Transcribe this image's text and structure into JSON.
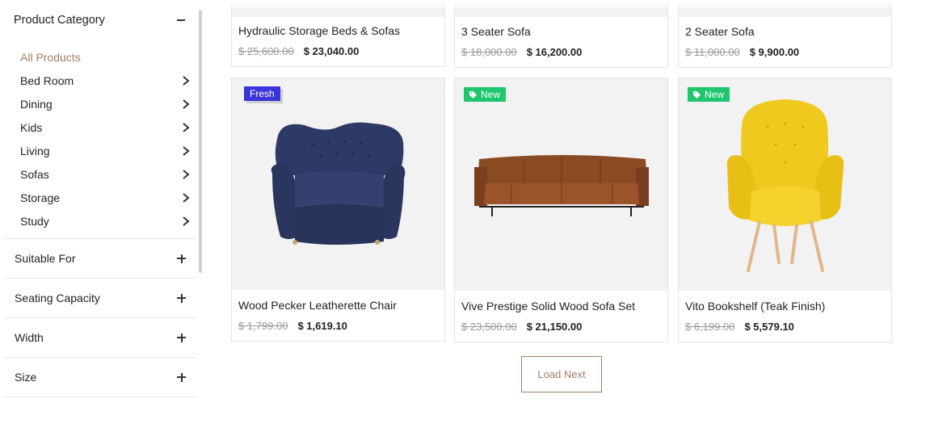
{
  "sidebar": {
    "category_title": "Product Category",
    "categories": [
      {
        "label": "All Products",
        "active": true
      },
      {
        "label": "Bed Room"
      },
      {
        "label": "Dining"
      },
      {
        "label": "Kids"
      },
      {
        "label": "Living"
      },
      {
        "label": "Sofas"
      },
      {
        "label": "Storage"
      },
      {
        "label": "Study"
      }
    ],
    "filters": [
      {
        "label": "Suitable For"
      },
      {
        "label": "Seating Capacity"
      },
      {
        "label": "Width"
      },
      {
        "label": "Size"
      }
    ]
  },
  "products": [
    {
      "name": "Hydraulic Storage Beds & Sofas",
      "old_price": "$ 25,600.00",
      "price": "$ 23,040.00"
    },
    {
      "name": "3 Seater Sofa",
      "old_price": "$ 18,000.00",
      "price": "$ 16,200.00"
    },
    {
      "name": "2 Seater Sofa",
      "old_price": "$ 11,000.00",
      "price": "$ 9,900.00"
    },
    {
      "name": "Wood Pecker Leatherette Chair",
      "old_price": "$ 1,799.00",
      "price": "$ 1,619.10",
      "badge": "Fresh"
    },
    {
      "name": "Vive Prestige Solid Wood Sofa Set",
      "old_price": "$ 23,500.00",
      "price": "$ 21,150.00",
      "badge": "New"
    },
    {
      "name": "Vito Bookshelf (Teak Finish)",
      "old_price": "$ 6,199.00",
      "price": "$ 5,579.10",
      "badge": "New"
    }
  ],
  "load_next": "Load Next",
  "colors": {
    "accent": "#a57d63",
    "fresh_badge": "#3b35d9",
    "new_badge": "#1fc66e"
  },
  "icons": {
    "collapse": "minus-icon",
    "expand": "plus-icon",
    "submenu": "chevron-right-icon",
    "badge": "tag-icon"
  }
}
